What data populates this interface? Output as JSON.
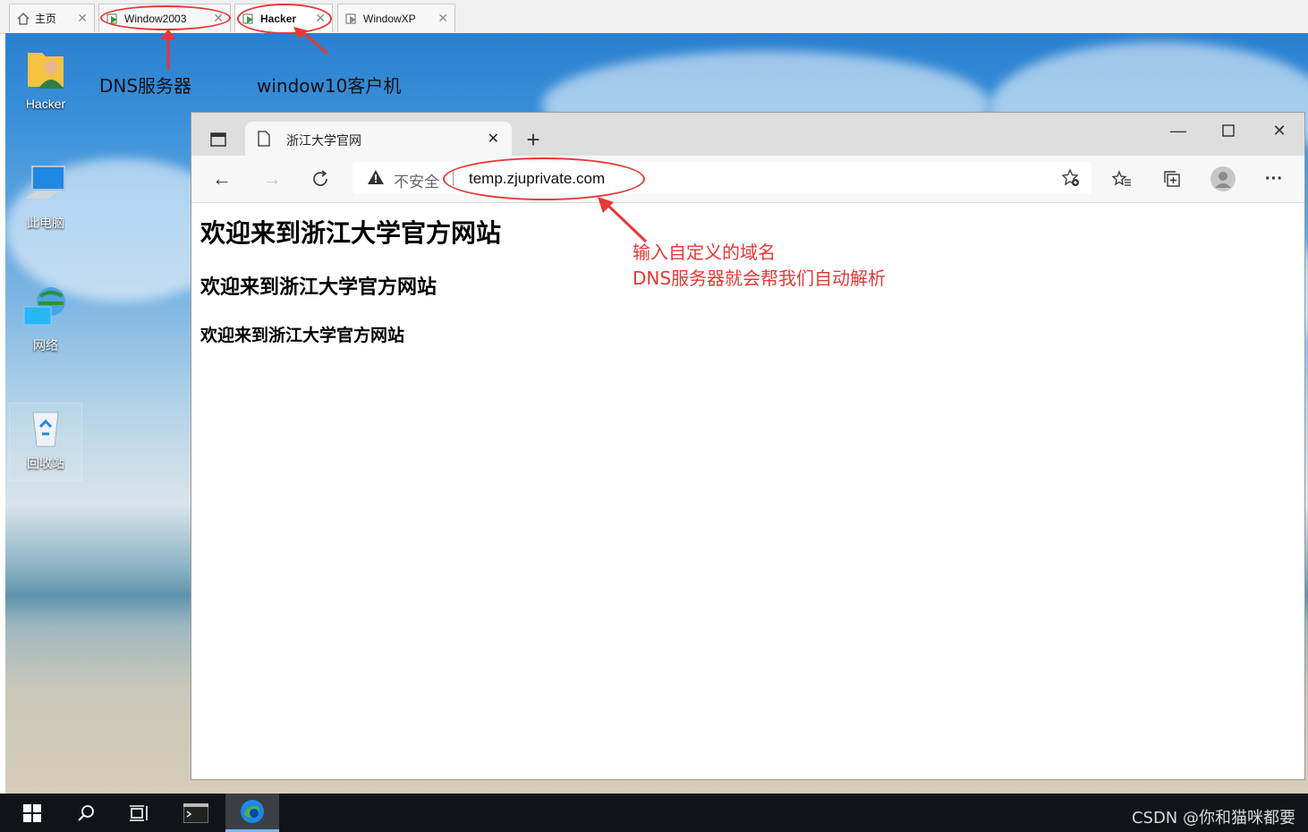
{
  "vm_tabs": [
    {
      "label": "主页",
      "icon": "home-icon"
    },
    {
      "label": "Window2003",
      "icon": "vm-icon"
    },
    {
      "label": "Hacker",
      "icon": "vm-icon"
    },
    {
      "label": "WindowXP",
      "icon": "vm-icon"
    }
  ],
  "desktop_icons": [
    {
      "label": "Hacker",
      "icon": "user-folder-icon"
    },
    {
      "label": "此电脑",
      "icon": "computer-icon"
    },
    {
      "label": "网络",
      "icon": "network-icon"
    },
    {
      "label": "回收站",
      "icon": "recycle-bin-icon"
    }
  ],
  "annotations": {
    "dns_server": "DNS服务器",
    "client": "window10客户机",
    "note_line1": "输入自定义的域名",
    "note_line2": "DNS服务器就会帮我们自动解析",
    "color": "#e53935"
  },
  "browser": {
    "tab_title": "浙江大学官网",
    "security_text": "不安全",
    "url": "temp.zjuprivate.com",
    "headings": {
      "h1": "欢迎来到浙江大学官方网站",
      "h2": "欢迎来到浙江大学官方网站",
      "h3": "欢迎来到浙江大学官方网站"
    }
  },
  "watermark": "CSDN @你和猫咪都要"
}
